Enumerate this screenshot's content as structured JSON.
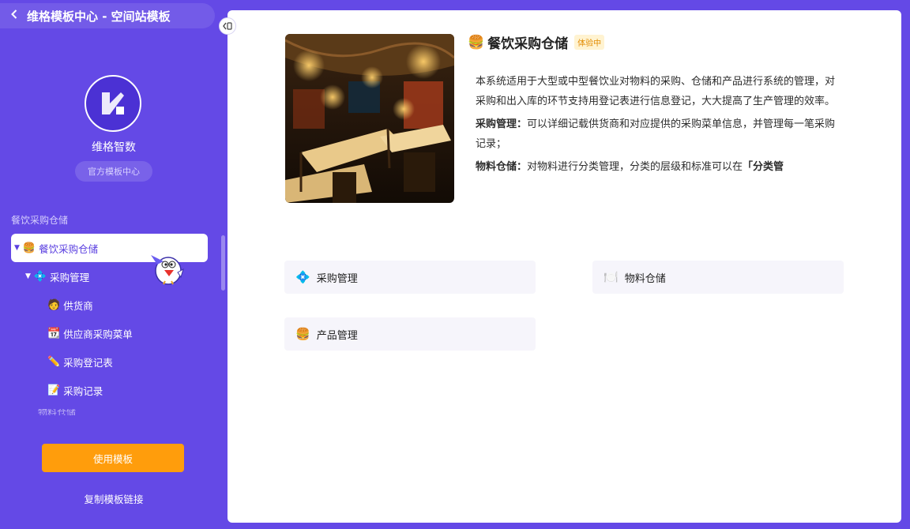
{
  "header": {
    "title": "维格模板中心 - 空间站模板"
  },
  "brand": {
    "name": "维格智数",
    "badge": "官方模板中心"
  },
  "sidebar": {
    "section_title": "餐饮采购仓储",
    "items": [
      {
        "label": "餐饮采购仓储",
        "icon": "hamburger-icon",
        "emoji": "🍔",
        "arrow": "▼"
      },
      {
        "label": "采购管理",
        "icon": "sparkle-icon",
        "emoji": "💠",
        "arrow": "▼"
      },
      {
        "label": "供货商",
        "icon": "person-icon",
        "emoji": "🧑"
      },
      {
        "label": "供应商采购菜单",
        "icon": "calendar-icon",
        "emoji": "📆"
      },
      {
        "label": "采购登记表",
        "icon": "pencil-icon",
        "emoji": "✏️"
      },
      {
        "label": "采购记录",
        "icon": "memo-icon",
        "emoji": "📝"
      }
    ],
    "partial_item": "物料仓储"
  },
  "actions": {
    "use_template": "使用模板",
    "copy_link": "复制模板链接"
  },
  "template": {
    "emoji": "🍔",
    "title": "餐饮采购仓储",
    "tag": "体验中",
    "desc_intro": "本系统适用于大型或中型餐饮业对物料的采购、仓储和产品进行系统的管理，对采购和出入库的环节支持用登记表进行信息登记，大大提高了生产管理的效率。",
    "desc_purchase_label": "采购管理：",
    "desc_purchase_text": "可以详细记载供货商和对应提供的采购菜单信息，并管理每一笔采购记录；",
    "desc_storage_label": "物料仓储：",
    "desc_storage_text": "对物料进行分类管理，分类的层级和标准可以在",
    "desc_storage_bold": "「分类管"
  },
  "cards": [
    {
      "label": "采购管理",
      "emoji": "💠",
      "icon": "sparkle-icon"
    },
    {
      "label": "物料仓储",
      "emoji": "🍽️",
      "icon": "plate-icon"
    },
    {
      "label": "产品管理",
      "emoji": "🍔",
      "icon": "hamburger-icon"
    }
  ],
  "colors": {
    "brand_purple": "#6449e6",
    "accent_orange": "#ff9d0c",
    "tag_bg": "#fff3d1",
    "tag_text": "#e28b00"
  }
}
